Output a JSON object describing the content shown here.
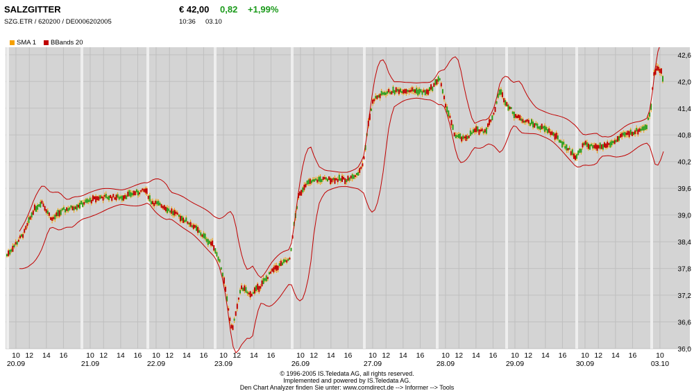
{
  "header": {
    "name": "SALZGITTER",
    "ids": "SZG.ETR  /  620200  /  DE0006202005",
    "price": "€ 42,00",
    "change": "0,82",
    "change_pct": "+1,99%",
    "time": "10:36",
    "date": "03.10"
  },
  "legend": [
    {
      "label": "SMA 1",
      "color": "#f5a000"
    },
    {
      "label": "BBands 20",
      "color": "#c00000"
    }
  ],
  "colors": {
    "plot_bg": "#d4d4d4",
    "gridline": "#bfbfbf",
    "day_separator": "#eeeeee",
    "band": "#c00000",
    "candle_up": "#2e9e1e",
    "candle_down": "#c00000",
    "candle_wick": "#f5a000",
    "positive": "#1a9a1a"
  },
  "chart_data": {
    "type": "line",
    "y_ticks": [
      "42,6",
      "42,0",
      "41,4",
      "40,8",
      "40,2",
      "39,6",
      "39,0",
      "38,4",
      "37,8",
      "37,2",
      "36,6",
      "36,0"
    ],
    "ylim": [
      36.0,
      42.8
    ],
    "hour_labels": [
      "10",
      "12",
      "14",
      "16",
      "10",
      "12",
      "14",
      "16",
      "10",
      "12",
      "14",
      "16",
      "10",
      "12",
      "14",
      "16",
      "10",
      "12",
      "14",
      "16",
      "10",
      "12",
      "14",
      "16",
      "10",
      "12",
      "14",
      "16",
      "10",
      "12",
      "14",
      "16",
      "10",
      "12",
      "14",
      "16",
      "10"
    ],
    "date_labels": [
      "20.09",
      "21.09",
      "22.09",
      "23.09",
      "26.09",
      "27.09",
      "28.09",
      "29.09",
      "30.09",
      "03.10"
    ],
    "x": [
      "20.09",
      "21.09",
      "22.09",
      "23.09",
      "26.09",
      "27.09",
      "28.09",
      "29.09",
      "30.09",
      "03.10"
    ],
    "series": [
      {
        "name": "SMA 1",
        "values": [
          38.3,
          39.3,
          39.4,
          37.5,
          40.0,
          41.7,
          41.0,
          41.1,
          40.4,
          42.0
        ]
      },
      {
        "name": "BBands 20",
        "values": [
          38.9,
          39.6,
          39.7,
          38.4,
          40.5,
          42.4,
          42.5,
          41.9,
          40.9,
          42.8
        ]
      }
    ]
  },
  "footer": {
    "line1": "© 1996-2005 IS.Teledata AG, all rights reserved.",
    "line2": "Implemented and powered by IS.Teledata AG.",
    "line3": "Den Chart Analyzer finden Sie unter: www.comdirect.de --> Informer --> Tools"
  }
}
